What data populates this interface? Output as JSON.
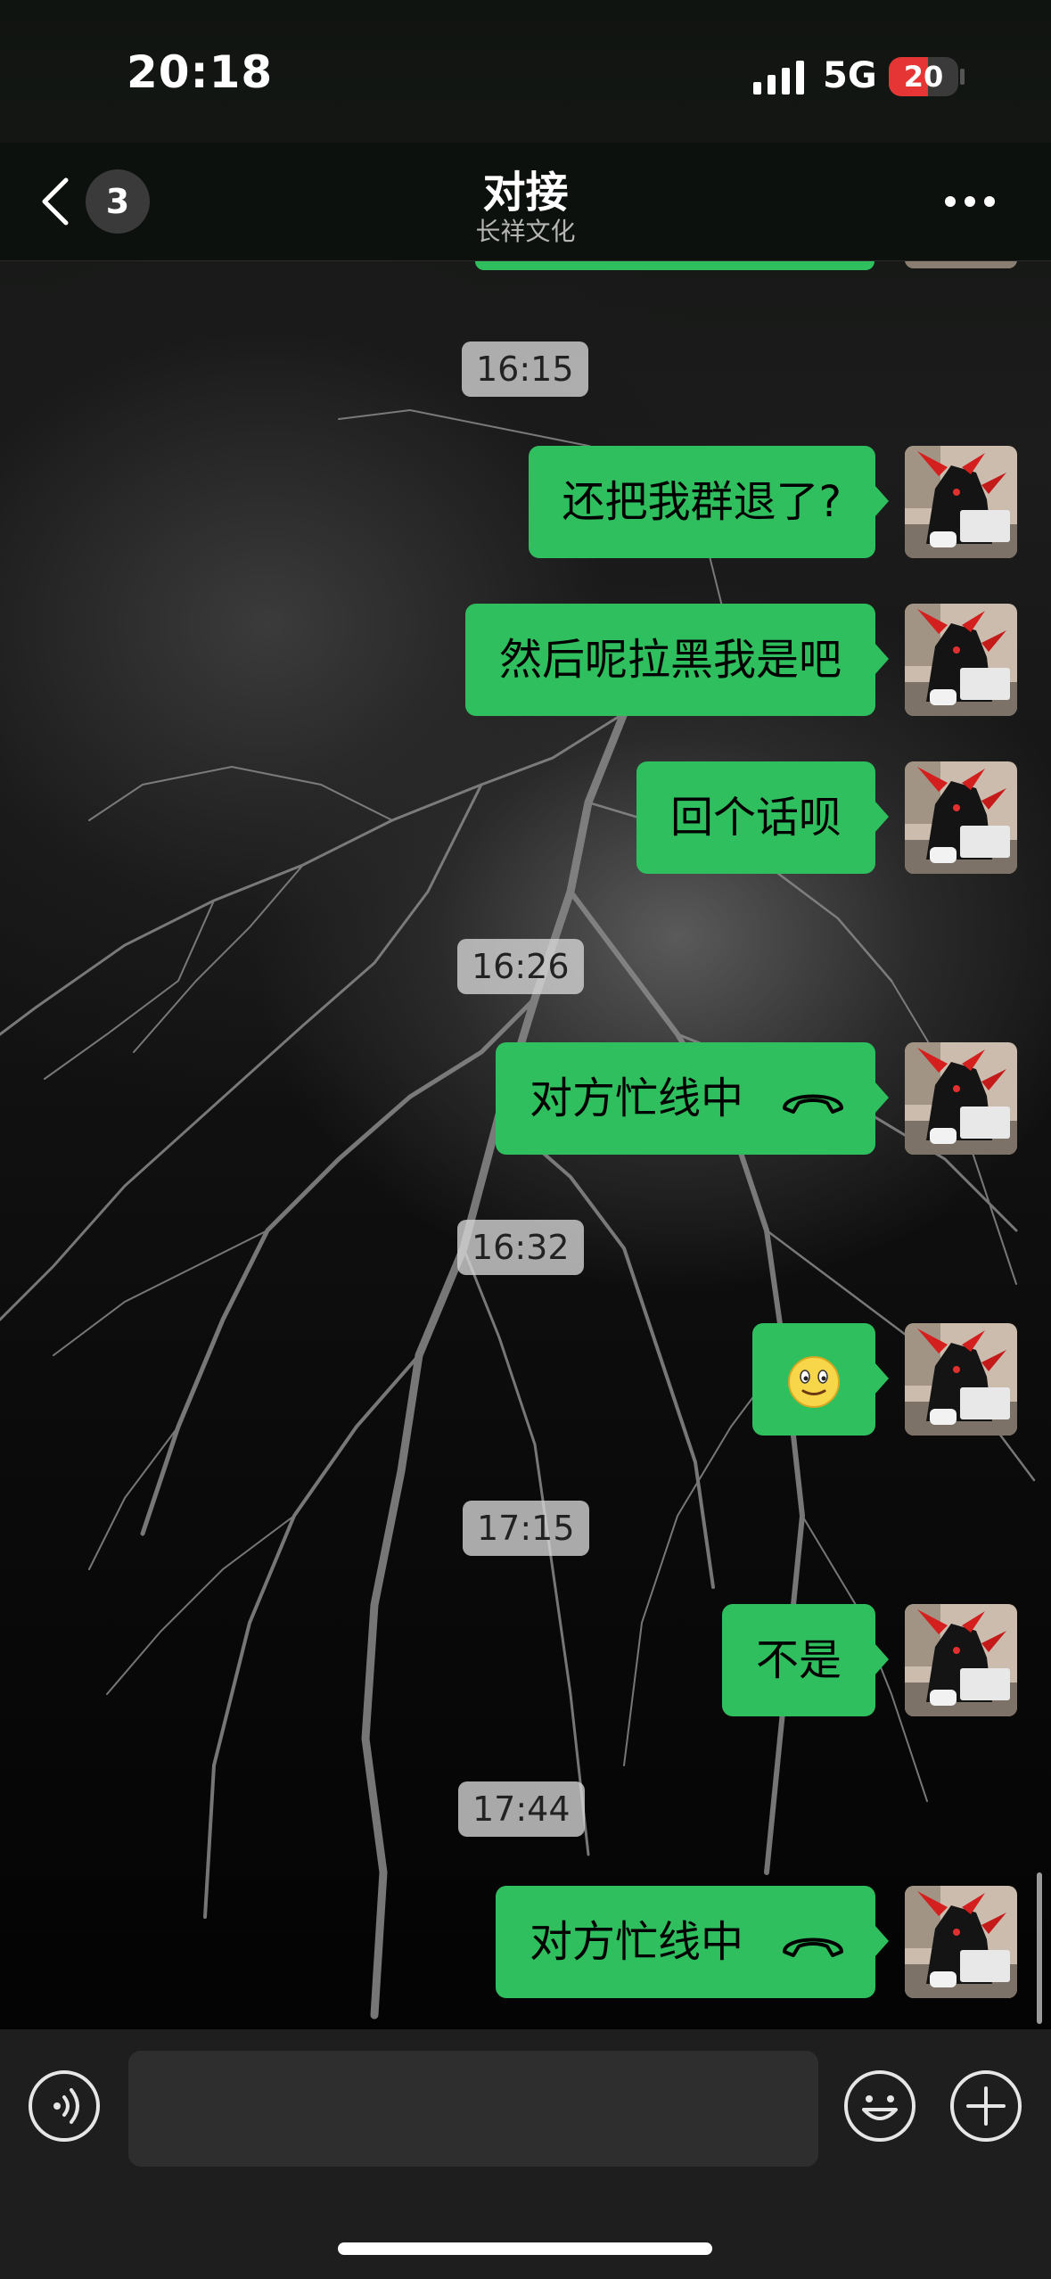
{
  "status_bar": {
    "time": "20:18",
    "network": "5G",
    "battery": "20"
  },
  "header": {
    "unread_count": "3",
    "title": "对接",
    "subtitle": "长祥文化"
  },
  "messages": [
    {
      "kind": "time",
      "text": "16:15"
    },
    {
      "kind": "text",
      "text": "还把我群退了?"
    },
    {
      "kind": "text",
      "text": "然后呢拉黑我是吧"
    },
    {
      "kind": "text",
      "text": "回个话呗"
    },
    {
      "kind": "time",
      "text": "16:26"
    },
    {
      "kind": "call",
      "text": "对方忙线中",
      "icon": "phone-hangup-icon"
    },
    {
      "kind": "time",
      "text": "16:32"
    },
    {
      "kind": "emoji",
      "icon": "smile-emoji-icon"
    },
    {
      "kind": "time",
      "text": "17:15"
    },
    {
      "kind": "text",
      "text": "不是"
    },
    {
      "kind": "time",
      "text": "17:44"
    },
    {
      "kind": "call",
      "text": "对方忙线中",
      "icon": "phone-hangup-icon"
    }
  ],
  "colors": {
    "bubble": "#2fbf5e",
    "badge": "#3a3a3a",
    "battery_low": "#e53535"
  },
  "input_bar": {
    "placeholder": ""
  }
}
